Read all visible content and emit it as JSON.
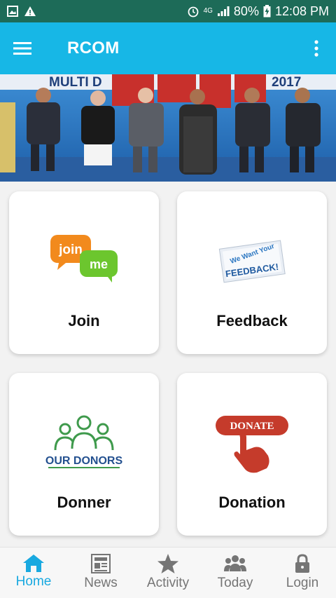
{
  "status_bar": {
    "network": "4G",
    "battery": "80%",
    "time": "12:08 PM"
  },
  "app_bar": {
    "title": "RCOM"
  },
  "banner": {
    "text_left": "MULTI D",
    "text_right": "2017"
  },
  "cards": [
    {
      "label": "Join",
      "icon": "join-me-icon",
      "icon_text_1": "join",
      "icon_text_2": "me"
    },
    {
      "label": "Feedback",
      "icon": "feedback-icon",
      "icon_text_1": "We Want Your",
      "icon_text_2": "FEEDBACK!"
    },
    {
      "label": "Donner",
      "icon": "our-donors-icon",
      "icon_text_1": "OUR DONORS"
    },
    {
      "label": "Donation",
      "icon": "donate-icon",
      "icon_text_1": "DONATE"
    }
  ],
  "bottom_nav": [
    {
      "label": "Home",
      "icon": "home-icon",
      "active": true
    },
    {
      "label": "News",
      "icon": "newspaper-icon",
      "active": false
    },
    {
      "label": "Activity",
      "icon": "star-icon",
      "active": false
    },
    {
      "label": "Today",
      "icon": "people-icon",
      "active": false
    },
    {
      "label": "Login",
      "icon": "lock-icon",
      "active": false
    }
  ],
  "colors": {
    "status_bar": "#1d6b58",
    "app_bar": "#17b7e6",
    "active_nav": "#19a9e0",
    "inactive_nav": "#757575"
  }
}
